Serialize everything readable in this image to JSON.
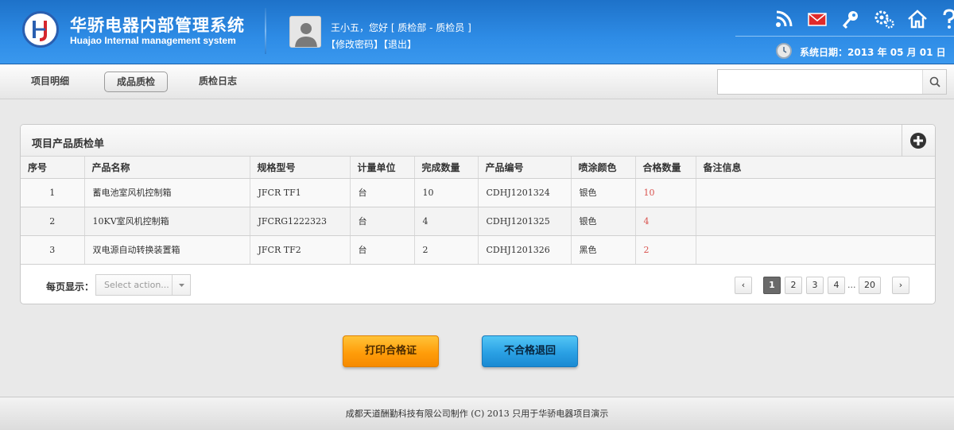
{
  "header": {
    "brand_cn": "华骄电器内部管理系统",
    "brand_en": "Huajao Internal management system",
    "greeting": "王小五，您好 [ 质检部 - 质检员 ]",
    "change_password": "【修改密码】",
    "logout": "【退出】",
    "date_text": "系统日期：2013 年 05 月 01 日",
    "icons": [
      "rss-icon",
      "mail-icon",
      "key-icon",
      "gears-icon",
      "home-icon",
      "help-icon"
    ]
  },
  "nav": {
    "tabs": [
      {
        "label": "项目明细",
        "active": false
      },
      {
        "label": "成品质检",
        "active": true
      },
      {
        "label": "质检日志",
        "active": false
      }
    ],
    "search_placeholder": ""
  },
  "panel": {
    "title": "项目产品质检单",
    "columns": [
      "序号",
      "产品名称",
      "规格型号",
      "计量单位",
      "完成数量",
      "产品编号",
      "喷涂颜色",
      "合格数量",
      "备注信息"
    ],
    "rows": [
      [
        "1",
        "蓄电池室风机控制箱",
        "JFCR TF1",
        "台",
        "10",
        "CDHJ1201324",
        "银色",
        "10",
        ""
      ],
      [
        "2",
        "10KV室风机控制箱",
        "JFCRG1222323",
        "台",
        "4",
        "CDHJ1201325",
        "银色",
        "4",
        ""
      ],
      [
        "3",
        "双电源自动转换装置箱",
        "JFCR TF2",
        "台",
        "2",
        "CDHJ1201326",
        "黑色",
        "2",
        ""
      ]
    ],
    "per_page_label": "每页显示：",
    "select_placeholder": "Select action...",
    "pages": [
      "1",
      "2",
      "3",
      "4",
      "20"
    ],
    "ellipsis": "...",
    "prev": "‹",
    "next": "›"
  },
  "actions": {
    "print": "打印合格证",
    "return": "不合格退回"
  },
  "footer": {
    "text": "成都天道酬勤科技有限公司制作 (C) 2013 只用于华骄电器项目演示"
  },
  "colors": {
    "header_blue": "#2e8ce6",
    "qualified_red": "#d9534f",
    "print_orange": "#ff9d0a",
    "return_blue": "#2aa0e4"
  }
}
